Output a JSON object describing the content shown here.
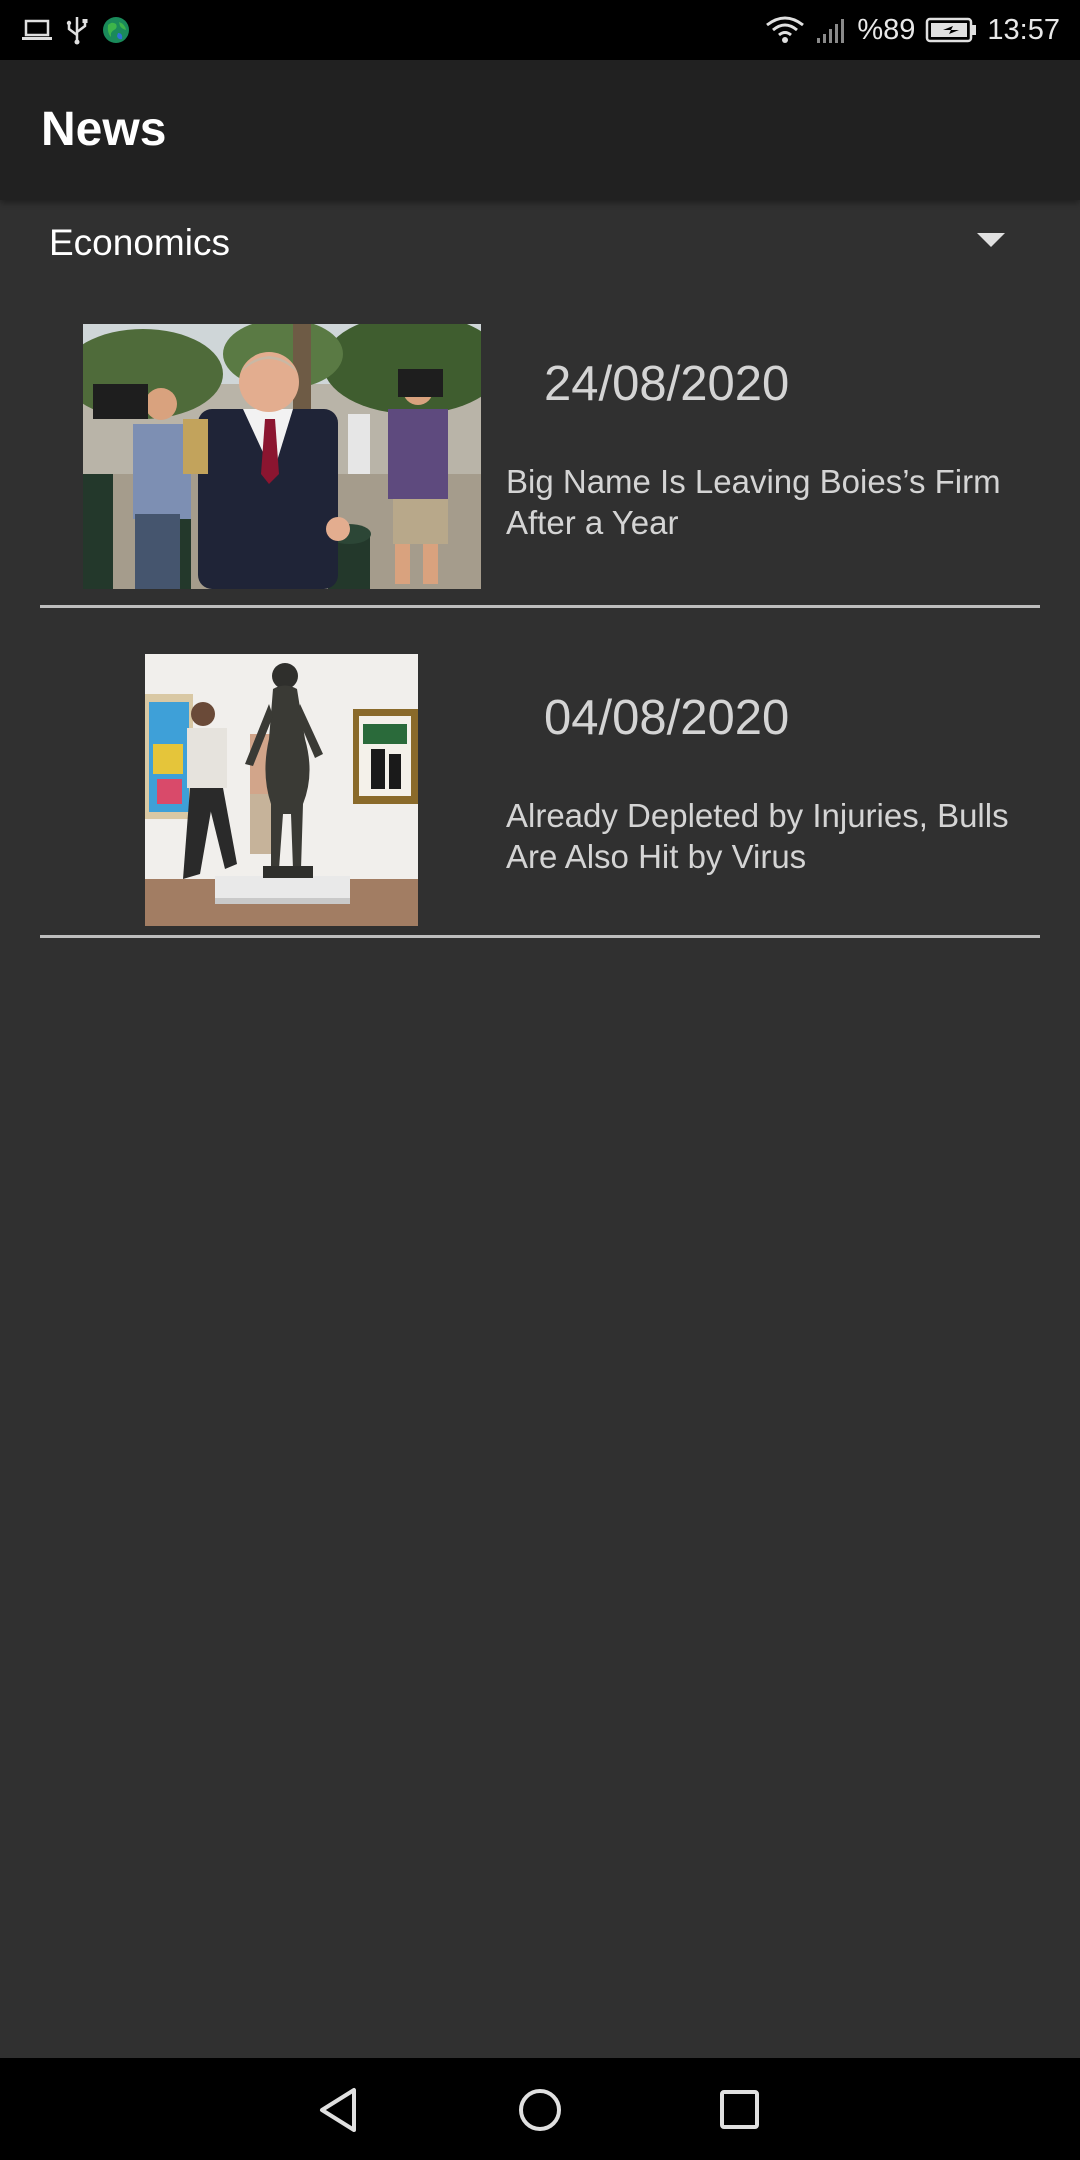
{
  "status_bar": {
    "battery_percent": "%89",
    "time": "13:57",
    "icons": [
      "laptop-icon",
      "usb-icon",
      "globe-icon",
      "wifi-icon",
      "signal-icon",
      "battery-icon"
    ]
  },
  "app_bar": {
    "title": "News"
  },
  "category_selector": {
    "selected": "Economics",
    "icon": "dropdown-arrow-icon"
  },
  "news": [
    {
      "date": "24/08/2020",
      "headline": "Big Name Is Leaving Boies’s Firm After a Year",
      "thumbnail": "photo of a man in suit walking with camera crew"
    },
    {
      "date": "04/08/2020",
      "headline": "Already Depleted by Injuries, Bulls Are Also Hit by Virus",
      "thumbnail": "photo of sculpture in art gallery"
    }
  ],
  "nav_bar": {
    "buttons": [
      "back-icon",
      "home-icon",
      "recents-icon"
    ]
  },
  "colors": {
    "background": "#303030",
    "app_bar": "#212121",
    "status_bar": "#000000",
    "text_primary": "#ffffff",
    "text_secondary": "#d4d4d4",
    "divider": "#bdbdbd"
  }
}
